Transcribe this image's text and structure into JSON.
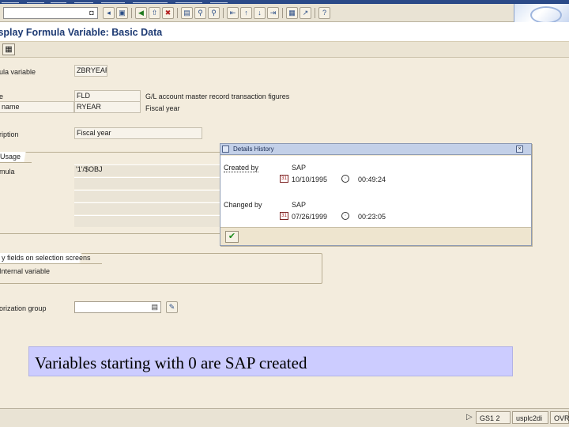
{
  "header": {
    "title": "isplay Formula Variable: Basic Data"
  },
  "command_field": {
    "value": "",
    "enter_glyph": "◘"
  },
  "toolbar": {
    "icons": [
      "save-icon",
      "back-icon",
      "exit-icon",
      "cancel-icon",
      "print-icon",
      "find-icon",
      "find-next-icon",
      "first-page-icon",
      "previous-page-icon",
      "next-page-icon",
      "last-page-icon",
      "create-session-icon",
      "shortcut-icon",
      "help-icon"
    ]
  },
  "app_toolbar": {
    "glyph": "▦"
  },
  "form": {
    "variable_label": "ula variable",
    "variable_value": "ZBRYEAR",
    "type_label": "e",
    "type_value": "FLD",
    "type_desc": "G/L account master record transaction figures",
    "name_label": "name",
    "name_value": "RYEAR",
    "name_desc": "Fiscal year",
    "description_label": "ription",
    "description_value": "Fiscal year",
    "usage_group_title": "Usage",
    "formula_label": "mula",
    "formula_value": "'1'/$OBJ",
    "selection_group_title": "y fields on selection screens",
    "selection_text": "Internal variable",
    "auth_label": "orization group",
    "auth_value": ""
  },
  "dialog": {
    "title": "Details History",
    "created_by_label": "Created by",
    "created_by_value": "SAP",
    "created_date": "10/10/1995",
    "created_time": "00:49:24",
    "changed_by_label": "Changed by",
    "changed_by_value": "SAP",
    "changed_date": "07/26/1999",
    "changed_time": "00:23:05",
    "calendar_glyph": "31",
    "confirm_glyph": "✔"
  },
  "caption": {
    "text": "Variables starting with 0 are SAP created"
  },
  "statusbar": {
    "arrow": "▷",
    "system": "GS1 2",
    "server": "usplc2di",
    "mode": "OVR"
  },
  "colors": {
    "caption_bg": "#ccccff",
    "title_text": "#1d3a73",
    "dialog_title_bg": "#c3d0e8"
  }
}
